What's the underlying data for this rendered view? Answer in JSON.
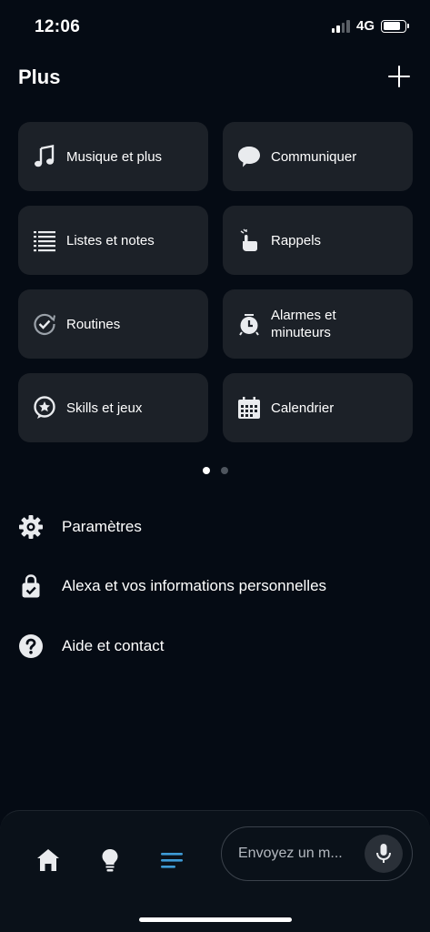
{
  "status_bar": {
    "time": "12:06",
    "network": "4G",
    "signal_bars_active": 2,
    "signal_bars_total": 4,
    "battery_level": 0.8
  },
  "header": {
    "title": "Plus",
    "add_icon": "plus-icon"
  },
  "tiles": [
    {
      "label": "Musique et plus",
      "icon": "music-note-icon"
    },
    {
      "label": "Communiquer",
      "icon": "speech-bubble-icon"
    },
    {
      "label": "Listes et notes",
      "icon": "list-icon"
    },
    {
      "label": "Rappels",
      "icon": "reminder-hand-icon"
    },
    {
      "label": "Routines",
      "icon": "routine-check-icon"
    },
    {
      "label": "Alarmes et minuteurs",
      "icon": "alarm-clock-icon"
    },
    {
      "label": "Skills et jeux",
      "icon": "skills-star-icon"
    },
    {
      "label": "Calendrier",
      "icon": "calendar-icon"
    }
  ],
  "pagination": {
    "pages": 2,
    "active": 1
  },
  "menu": [
    {
      "label": "Paramètres",
      "icon": "gear-icon"
    },
    {
      "label": "Alexa et vos informations personnelles",
      "icon": "privacy-lock-icon"
    },
    {
      "label": "Aide et contact",
      "icon": "help-icon"
    }
  ],
  "bottom_nav": {
    "items": [
      {
        "icon": "home-icon"
      },
      {
        "icon": "lightbulb-icon"
      },
      {
        "icon": "more-lines-icon",
        "active": true
      }
    ],
    "message_placeholder": "Envoyez un m...",
    "mic_icon": "microphone-icon"
  },
  "colors": {
    "background": "#050b14",
    "tile": "#1c2128",
    "accent": "#3e9bd6",
    "icon": "#e9ebee"
  }
}
